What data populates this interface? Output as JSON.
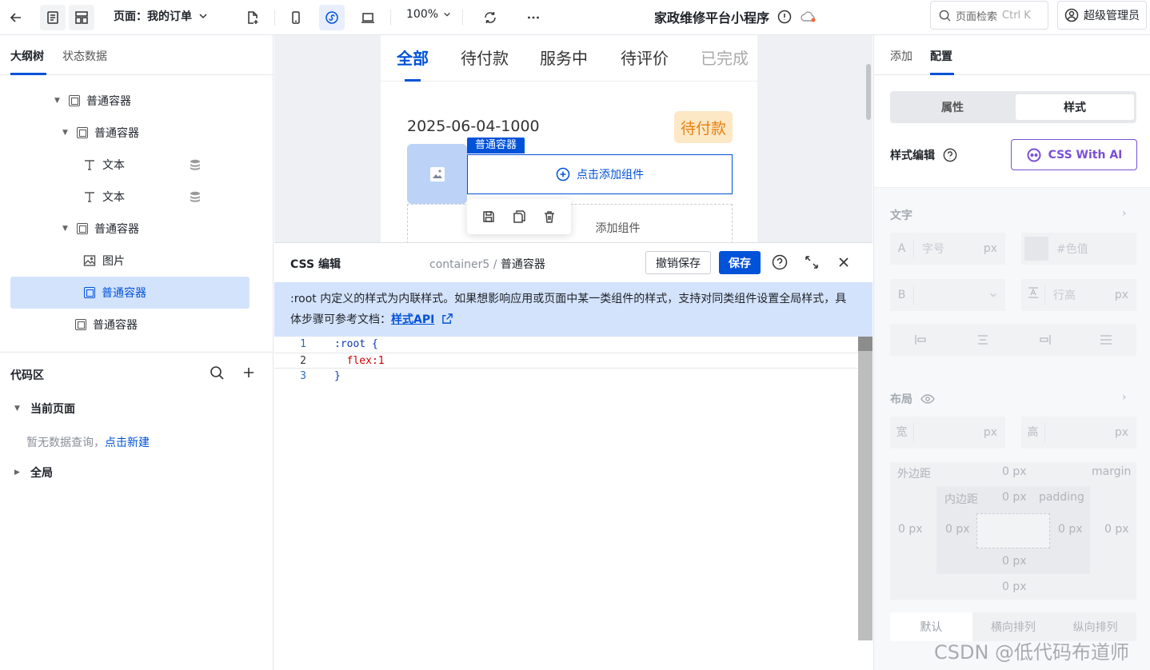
{
  "topbar": {
    "page_label": "页面：我的订单",
    "zoom": "100%",
    "app_title": "家政维修平台小程序",
    "search_placeholder": "页面检索",
    "search_shortcut": "Ctrl K",
    "user_name": "超级管理员"
  },
  "left": {
    "tabs": [
      "大纲树",
      "状态数据"
    ],
    "tree": [
      {
        "label": "普通容器",
        "type": "container"
      },
      {
        "label": "普通容器",
        "type": "container"
      },
      {
        "label": "文本",
        "type": "text"
      },
      {
        "label": "文本",
        "type": "text"
      },
      {
        "label": "普通容器",
        "type": "container"
      },
      {
        "label": "图片",
        "type": "image"
      },
      {
        "label": "普通容器",
        "type": "container"
      },
      {
        "label": "普通容器",
        "type": "container"
      }
    ],
    "code_area": {
      "title": "代码区",
      "current_page": "当前页面",
      "empty_text": "暂无数据查询，",
      "create_link": "点击新建",
      "global": "全局"
    }
  },
  "canvas": {
    "tabs": [
      "全部",
      "待付款",
      "服务中",
      "待评价",
      "已完成"
    ],
    "order_no": "2025-06-04-1000",
    "status_badge": "待付款",
    "selected_tag": "普通容器",
    "add_component": "点击添加组件",
    "add_component_2": "添加组件"
  },
  "editor": {
    "title": "CSS 编辑",
    "crumb_parent": "container5",
    "crumb_sep": "/",
    "crumb_current": "普通容器",
    "cancel_label": "撤销保存",
    "save_label": "保存",
    "tip_text": ":root 内定义的样式为内联样式。如果想影响应用或页面中某一类组件的样式，支持对同类组件设置全局样式，具体步骤可参考文档：",
    "tip_link": "样式API",
    "code_lines": [
      {
        "num": "1",
        "text": ":root {"
      },
      {
        "num": "2",
        "text": "  flex:1"
      },
      {
        "num": "3",
        "text": "}"
      }
    ]
  },
  "right": {
    "tabs": [
      "添加",
      "配置"
    ],
    "segments": [
      "属性",
      "样式"
    ],
    "style_edit": "样式编辑",
    "ai_button": "CSS With AI",
    "text_section": "文字",
    "font_size_prefix": "A",
    "font_size_placeholder": "字号",
    "unit_px": "px",
    "color_placeholder": "#色值",
    "weight_prefix": "B",
    "line_height_placeholder": "行高",
    "layout_section": "布局",
    "width_label": "宽",
    "height_label": "高",
    "margin_label": "外边距",
    "margin_en": "margin",
    "padding_label": "内边距",
    "padding_en": "padding",
    "zero_px": "0 px",
    "layout_modes": [
      "默认",
      "横向排列",
      "纵向排列"
    ]
  },
  "watermark": "CSDN @低代码布道师",
  "colors": {
    "accent": "#0052d9",
    "selected_bg": "#d4e3fc",
    "badge_bg": "#fde8c6",
    "badge_text": "#e6820e",
    "ai_purple": "#7b4fd8"
  }
}
